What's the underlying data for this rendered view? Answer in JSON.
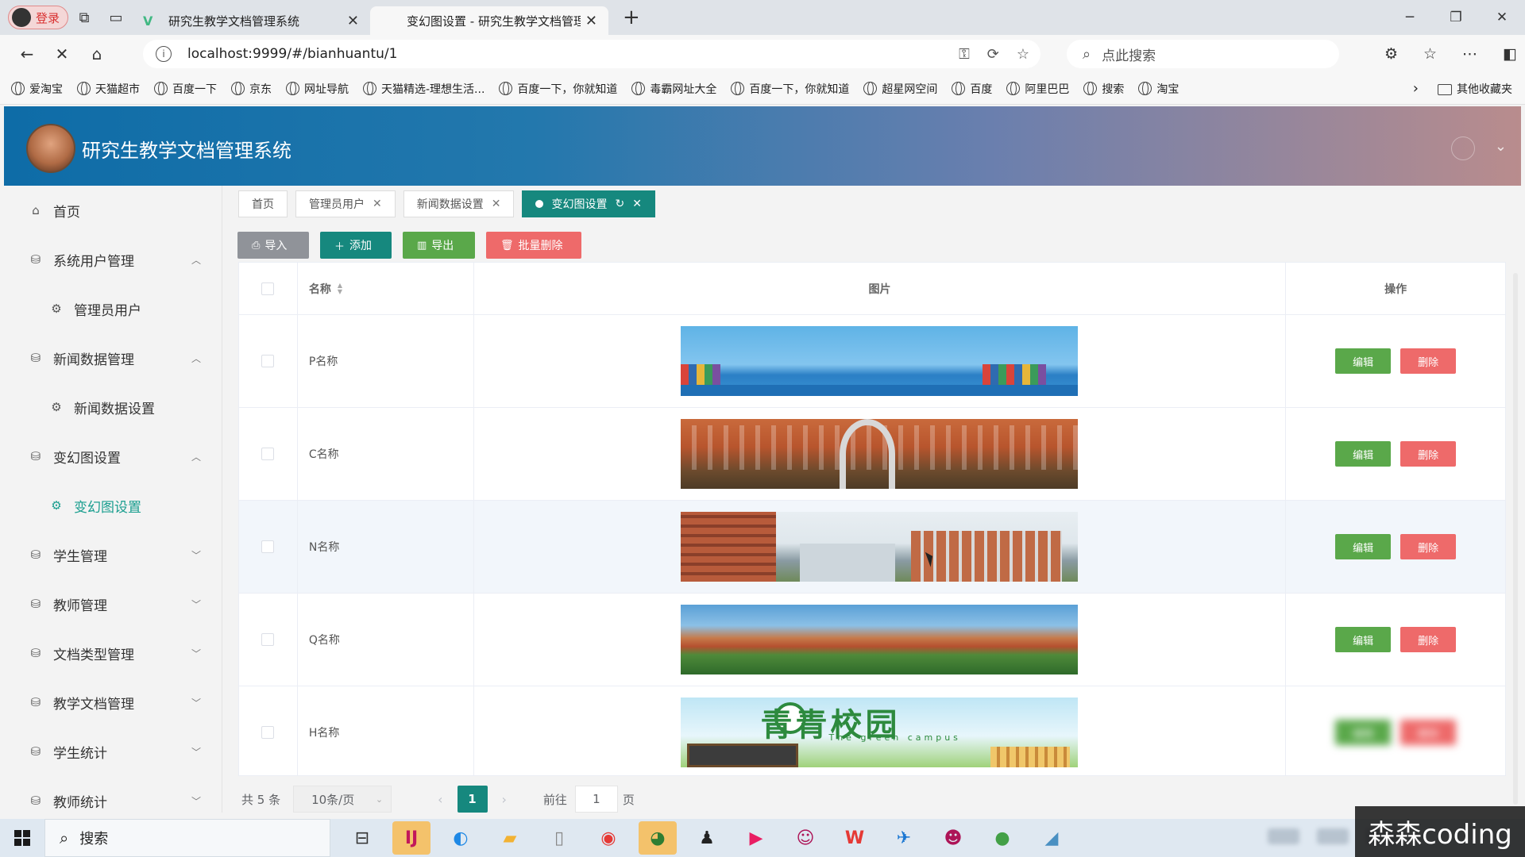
{
  "browser": {
    "profile_label": "登录",
    "tabs": [
      {
        "title": "研究生教学文档管理系统"
      },
      {
        "title": "变幻图设置 - 研究生教学文档管理"
      }
    ],
    "url": "localhost:9999/#/bianhuantu/1",
    "search_placeholder": "点此搜索",
    "bookmarks": [
      "爱淘宝",
      "天猫超市",
      "百度一下",
      "京东",
      "网址导航",
      "天猫精选-理想生活...",
      "百度一下，你就知道",
      "毒霸网址大全",
      "百度一下，你就知道",
      "超星网空间",
      "百度",
      "阿里巴巴",
      "搜索",
      "淘宝"
    ],
    "other_bookmarks": "其他收藏夹"
  },
  "app": {
    "title": "研究生教学文档管理系统"
  },
  "sidebar": {
    "items": [
      {
        "label": "首页",
        "icon": "home-icon",
        "type": "top"
      },
      {
        "label": "系统用户管理",
        "icon": "menu-icon",
        "type": "group",
        "caret": "up"
      },
      {
        "label": "管理员用户",
        "icon": "gear-icon",
        "type": "sub"
      },
      {
        "label": "新闻数据管理",
        "icon": "menu-icon",
        "type": "group",
        "caret": "up"
      },
      {
        "label": "新闻数据设置",
        "icon": "gear-icon",
        "type": "sub"
      },
      {
        "label": "变幻图设置",
        "icon": "menu-icon",
        "type": "group",
        "caret": "up"
      },
      {
        "label": "变幻图设置",
        "icon": "gear-icon",
        "type": "sub",
        "active": true
      },
      {
        "label": "学生管理",
        "icon": "menu-icon",
        "type": "group",
        "caret": "down"
      },
      {
        "label": "教师管理",
        "icon": "menu-icon",
        "type": "group",
        "caret": "down"
      },
      {
        "label": "文档类型管理",
        "icon": "menu-icon",
        "type": "group",
        "caret": "down"
      },
      {
        "label": "教学文档管理",
        "icon": "menu-icon",
        "type": "group",
        "caret": "down"
      },
      {
        "label": "学生统计",
        "icon": "menu-icon",
        "type": "group",
        "caret": "down"
      },
      {
        "label": "教师统计",
        "icon": "menu-icon",
        "type": "group",
        "caret": "down"
      }
    ]
  },
  "tags": [
    {
      "label": "首页",
      "closable": false
    },
    {
      "label": "管理员用户",
      "closable": true
    },
    {
      "label": "新闻数据设置",
      "closable": true
    },
    {
      "label": "变幻图设置",
      "closable": true,
      "active": true
    }
  ],
  "toolbar": {
    "import_label": "导入",
    "add_label": "添加",
    "export_label": "导出",
    "batch_delete_label": "批量删除"
  },
  "table": {
    "columns": {
      "name": "名称",
      "image": "图片",
      "actions": "操作"
    },
    "rows": [
      {
        "name": "P名称",
        "banner": "bn1"
      },
      {
        "name": "C名称",
        "banner": "bn2"
      },
      {
        "name": "N名称",
        "banner": "bn3"
      },
      {
        "name": "Q名称",
        "banner": "bn4"
      },
      {
        "name": "H名称",
        "banner": "bn5",
        "banner_title": "青青校园",
        "banner_subtitle": "The green campus"
      }
    ],
    "edit_label": "编辑",
    "delete_label": "删除"
  },
  "pager": {
    "total": "共 5 条",
    "page_size": "10条/页",
    "current_page": "1",
    "goto_prefix": "前往",
    "goto_value": "1",
    "goto_suffix": "页"
  },
  "taskbar": {
    "search_label": "搜索"
  },
  "watermark": "森森coding"
}
